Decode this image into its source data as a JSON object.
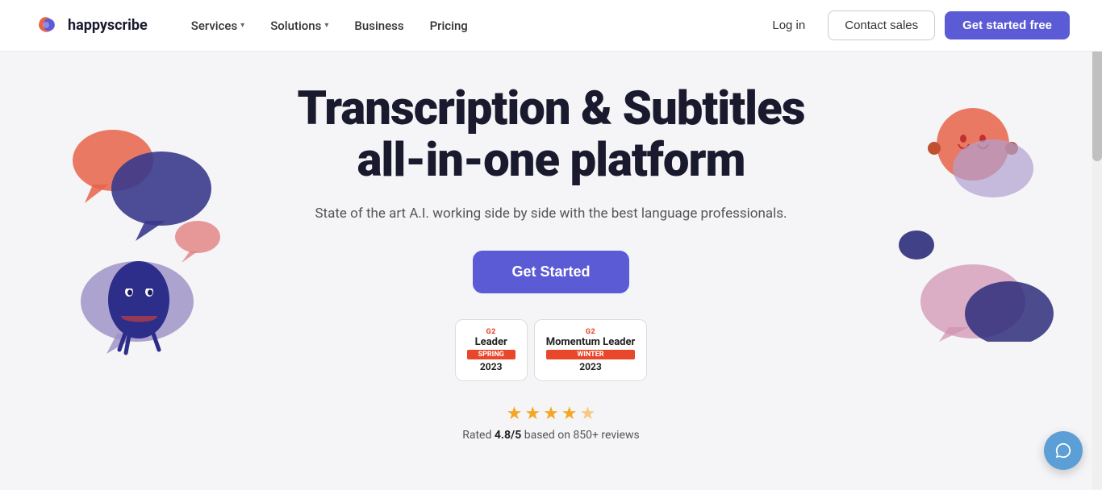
{
  "nav": {
    "logo_text": "happyscribe",
    "links": [
      {
        "label": "Services",
        "has_dropdown": true
      },
      {
        "label": "Solutions",
        "has_dropdown": true
      },
      {
        "label": "Business",
        "has_dropdown": false
      },
      {
        "label": "Pricing",
        "has_dropdown": false
      }
    ],
    "login_label": "Log in",
    "contact_label": "Contact sales",
    "cta_label": "Get started free"
  },
  "hero": {
    "title_line1": "Transcription & Subtitles",
    "title_line2": "all-in-one platform",
    "subtitle": "State of the art A.I. working side by side with the best language professionals.",
    "cta_label": "Get Started",
    "badges": [
      {
        "g2_label": "G2",
        "title": "Leader",
        "season": "SPRING",
        "year": "2023"
      },
      {
        "g2_label": "G2",
        "title": "Momentum Leader",
        "season": "WINTER",
        "year": "2023"
      }
    ],
    "stars_count": "4.8/5",
    "rating_text": "based on 850+ reviews",
    "rating_prefix": "Rated"
  },
  "support": {
    "icon": "chat-icon"
  },
  "colors": {
    "accent": "#5b5bd6",
    "coral": "#e8634a",
    "navy": "#2d2d7a",
    "lavender": "#9b8ec4",
    "pink_light": "#f0a0a0",
    "speech_red": "#e8634a",
    "speech_blue": "#4a4a9c",
    "speech_purple": "#b0a0d0"
  }
}
